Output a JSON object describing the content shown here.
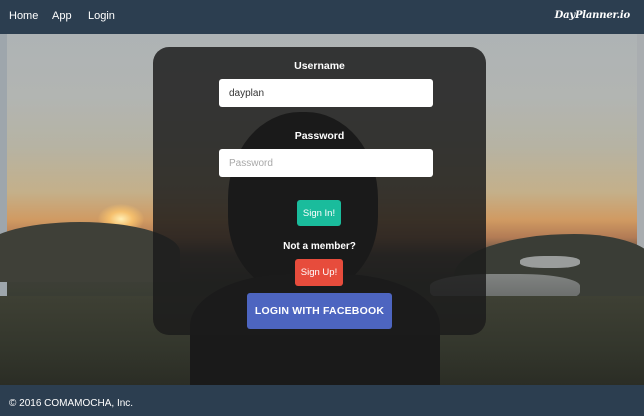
{
  "nav": {
    "items": [
      {
        "label": "Home"
      },
      {
        "label": "App"
      },
      {
        "label": "Login"
      }
    ],
    "brand": "DayPlanner.io"
  },
  "login_form": {
    "username_label": "Username",
    "username_value": "dayplan",
    "password_label": "Password",
    "password_placeholder": "Password",
    "sign_in_label": "Sign In!",
    "not_member_text": "Not a member?",
    "sign_up_label": "Sign Up!",
    "facebook_label": "LOGIN WITH FACEBOOK"
  },
  "footer": {
    "text": "© 2016 COMAMOCHA, Inc."
  },
  "colors": {
    "navbar": "#2c3e50",
    "sign_in": "#1abc9c",
    "sign_up": "#e74c3c",
    "facebook": "#4d65c0"
  }
}
